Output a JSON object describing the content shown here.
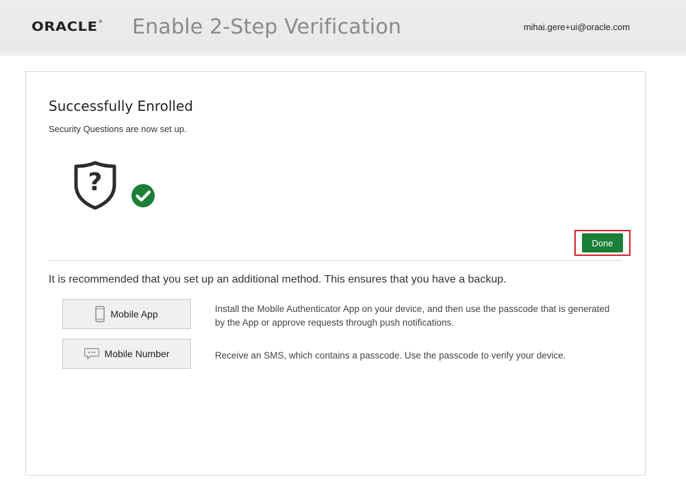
{
  "header": {
    "logo_text": "ORACLE",
    "logo_mark": "®",
    "title": "Enable 2-Step Verification",
    "user_email": "mihai.gere+ui@oracle.com"
  },
  "enrollment": {
    "title": "Successfully Enrolled",
    "subtitle": "Security Questions are now set up.",
    "icons": [
      "shield-question-icon",
      "check-circle-icon"
    ],
    "success_color": "#1b7f38",
    "done_label": "Done",
    "done_highlight_color": "#d21f2a"
  },
  "recommendation": {
    "text": "It is recommended that you set up an additional method. This ensures that you have a backup.",
    "methods": [
      {
        "label": "Mobile App",
        "icon": "phone-icon",
        "description": "Install the Mobile Authenticator App on your device, and then use the passcode that is generated by the App or approve requests through push notifications."
      },
      {
        "label": "Mobile Number",
        "icon": "sms-icon",
        "description": "Receive an SMS, which contains a passcode. Use the passcode to verify your device."
      }
    ]
  }
}
